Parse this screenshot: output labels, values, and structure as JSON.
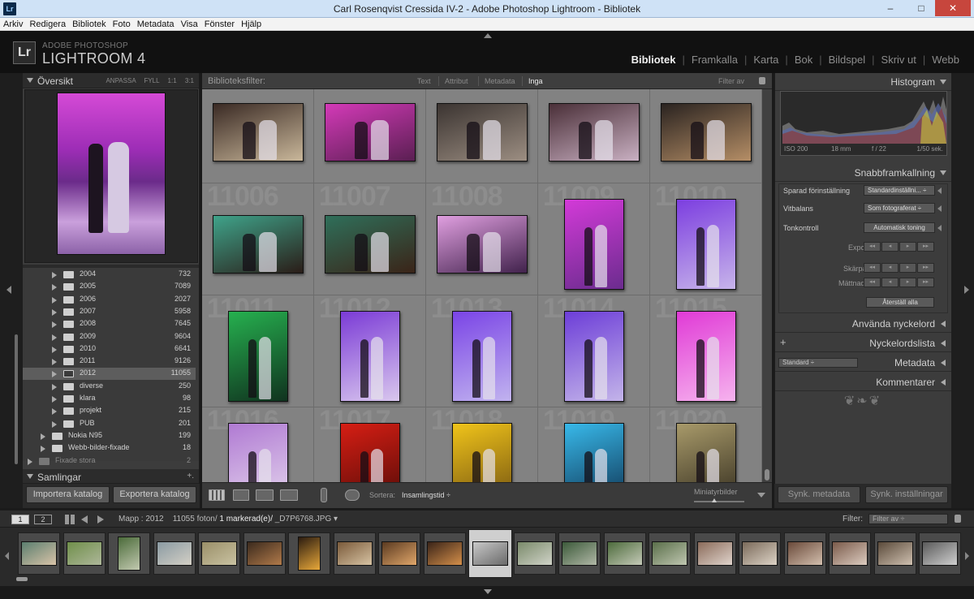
{
  "window": {
    "title": "Carl Rosenqvist Cressida IV-2 - Adobe Photoshop Lightroom - Bibliotek",
    "app_icon": "Lr",
    "minimize": "–",
    "maximize": "□",
    "close": "✕"
  },
  "menu": [
    "Arkiv",
    "Redigera",
    "Bibliotek",
    "Foto",
    "Metadata",
    "Visa",
    "Fönster",
    "Hjälp"
  ],
  "brand": {
    "logo": "Lr",
    "line1": "ADOBE PHOTOSHOP",
    "line2": "LIGHTROOM 4"
  },
  "modules": [
    "Bibliotek",
    "Framkalla",
    "Karta",
    "Bok",
    "Bildspel",
    "Skriv ut",
    "Webb"
  ],
  "active_module": "Bibliotek",
  "left": {
    "navigator": {
      "title": "Översikt",
      "options": [
        "ANPASSA",
        "FYLL",
        "1:1",
        "3:1"
      ]
    },
    "folders": [
      {
        "name": "2004",
        "count": "732",
        "indent": 1
      },
      {
        "name": "2005",
        "count": "7089",
        "indent": 1
      },
      {
        "name": "2006",
        "count": "2027",
        "indent": 1
      },
      {
        "name": "2007",
        "count": "5958",
        "indent": 1
      },
      {
        "name": "2008",
        "count": "7645",
        "indent": 1
      },
      {
        "name": "2009",
        "count": "9604",
        "indent": 1
      },
      {
        "name": "2010",
        "count": "6641",
        "indent": 1
      },
      {
        "name": "2011",
        "count": "9126",
        "indent": 1
      },
      {
        "name": "2012",
        "count": "11055",
        "indent": 1,
        "selected": true
      },
      {
        "name": "diverse",
        "count": "250",
        "indent": 1
      },
      {
        "name": "klara",
        "count": "98",
        "indent": 1
      },
      {
        "name": "projekt",
        "count": "215",
        "indent": 1
      },
      {
        "name": "PUB",
        "count": "201",
        "indent": 1
      },
      {
        "name": "Nokia N95",
        "count": "199",
        "indent": 0
      },
      {
        "name": "Webb-bilder-fixade",
        "count": "18",
        "indent": 0
      },
      {
        "name": "Fixade stora",
        "count": "2",
        "indent": -1,
        "dim": true
      }
    ],
    "collections": {
      "title": "Samlingar",
      "add": "+."
    },
    "buttons": {
      "import": "Importera katalog",
      "export": "Exportera katalog"
    }
  },
  "filter": {
    "label": "Biblioteksfilter:",
    "tabs": [
      "Text",
      "Attribut",
      "Metadata",
      "Inga"
    ],
    "active": "Inga",
    "preset": "Filter av"
  },
  "grid": {
    "cells": [
      {
        "num": "",
        "c1": "#3a2a24",
        "c2": "#c9b79a",
        "orient": "land"
      },
      {
        "num": "",
        "c1": "#d43ab8",
        "c2": "#5a1f52",
        "orient": "land"
      },
      {
        "num": "",
        "c1": "#3b3431",
        "c2": "#9c8e82",
        "orient": "land"
      },
      {
        "num": "",
        "c1": "#4a2f38",
        "c2": "#c9b0c2",
        "orient": "land"
      },
      {
        "num": "",
        "c1": "#2a2320",
        "c2": "#b58e66",
        "orient": "land"
      },
      {
        "num": "11006",
        "c1": "#3fa38a",
        "c2": "#2a1d18",
        "orient": "land"
      },
      {
        "num": "11007",
        "c1": "#2f6f5a",
        "c2": "#3a2418",
        "orient": "land"
      },
      {
        "num": "11008",
        "c1": "#e09fe0",
        "c2": "#41224c",
        "orient": "land"
      },
      {
        "num": "11009",
        "c1": "#d33ad8",
        "c2": "#6b2c8e",
        "orient": "port"
      },
      {
        "num": "11010",
        "c1": "#7c3ee0",
        "c2": "#c7b4ea",
        "orient": "port"
      },
      {
        "num": "11011",
        "c1": "#26b04f",
        "c2": "#10331f",
        "orient": "port"
      },
      {
        "num": "11012",
        "c1": "#7b3bd6",
        "c2": "#d9c7ee",
        "orient": "port"
      },
      {
        "num": "11013",
        "c1": "#7a44e6",
        "c2": "#c1b3ef",
        "orient": "port"
      },
      {
        "num": "11014",
        "c1": "#6d3ed8",
        "c2": "#c3b4e9",
        "orient": "port"
      },
      {
        "num": "11015",
        "c1": "#e03ad6",
        "c2": "#f6b3ee",
        "orient": "port"
      },
      {
        "num": "11016",
        "c1": "#b07ad3",
        "c2": "#e8dcef",
        "orient": "port"
      },
      {
        "num": "11017",
        "c1": "#d61e14",
        "c2": "#4a0a06",
        "orient": "port"
      },
      {
        "num": "11018",
        "c1": "#f0c41a",
        "c2": "#6a4a10",
        "orient": "port"
      },
      {
        "num": "11019",
        "c1": "#38b9ea",
        "c2": "#0c2a48",
        "orient": "port"
      },
      {
        "num": "11020",
        "c1": "#a89a6a",
        "c2": "#2a2418",
        "orient": "port"
      }
    ]
  },
  "toolbar": {
    "sort_label": "Sortera:",
    "sort_value": "Insamlingstid ÷",
    "thumb_label": "Miniatyrbilder"
  },
  "right": {
    "histogram": {
      "title": "Histogram",
      "info": [
        "ISO 200",
        "18 mm",
        "f / 22",
        "1/50 sek."
      ]
    },
    "quick": {
      "title": "Snabbframkallning",
      "saved_label": "Sparad förinställning",
      "saved_value": "Standardinställni... ÷",
      "wb_label": "Vitbalans",
      "wb_value": "Som fotograferat ÷",
      "tone_label": "Tonkontroll",
      "tone_button": "Automatisk toning",
      "exposure": "Exponering",
      "sharp": "Skärpa",
      "sat": "Mättnad",
      "step_buttons": [
        "◂◂",
        "◂",
        "▸",
        "▸▸"
      ],
      "reset": "Återställ alla"
    },
    "keywording": "Använda nyckelord",
    "keywordlist": "Nyckelordslista",
    "kw_plus": "+",
    "metadata": "Metadata",
    "metadata_preset": "Standard ÷",
    "comments": "Kommentarer",
    "ornament": "❦❧❦",
    "sync_meta": "Synk. metadata",
    "sync_settings": "Synk. inställningar"
  },
  "strip": {
    "monitor1": "1",
    "monitor2": "2",
    "path": "Mapp : 2012",
    "counts": "11055 foton/",
    "selected": "1 markerad(e)/",
    "filename": "_D7P6768.JPG ▾",
    "filter_label": "Filter:",
    "filter_value": "Filter av ÷",
    "thumbs": [
      {
        "c1": "#5b7e6e",
        "c2": "#d8c3a8",
        "orient": "land"
      },
      {
        "c1": "#6f8f4a",
        "c2": "#aeb79a",
        "orient": "land"
      },
      {
        "c1": "#4b6b3a",
        "c2": "#c2c9b0",
        "orient": "port"
      },
      {
        "c1": "#8a9aa2",
        "c2": "#d4d0c6",
        "orient": "land"
      },
      {
        "c1": "#9a8f68",
        "c2": "#c9c2a2",
        "orient": "land"
      },
      {
        "c1": "#3b2a1d",
        "c2": "#b17a4a",
        "orient": "land"
      },
      {
        "c1": "#2b1c10",
        "c2": "#e8a83a",
        "orient": "port"
      },
      {
        "c1": "#7a5a3a",
        "c2": "#d7c3a3",
        "orient": "land"
      },
      {
        "c1": "#5a3a20",
        "c2": "#e0a66a",
        "orient": "land"
      },
      {
        "c1": "#3a2418",
        "c2": "#d48f4a",
        "orient": "land"
      },
      {
        "c1": "#c8c8c8",
        "c2": "#6a6a6a",
        "orient": "land",
        "sel": true
      },
      {
        "c1": "#7a8a6a",
        "c2": "#d0d3c8",
        "orient": "land"
      },
      {
        "c1": "#3c5a3a",
        "c2": "#b0b7a6",
        "orient": "land"
      },
      {
        "c1": "#4d6b3c",
        "c2": "#c5cab8",
        "orient": "land"
      },
      {
        "c1": "#5a6f4a",
        "c2": "#bfc6b0",
        "orient": "land"
      },
      {
        "c1": "#8a6b5a",
        "c2": "#e0d4cc",
        "orient": "land"
      },
      {
        "c1": "#7a6a5a",
        "c2": "#ddd3c6",
        "orient": "land"
      },
      {
        "c1": "#6a4a3a",
        "c2": "#d3bfae",
        "orient": "land"
      },
      {
        "c1": "#7a5a4a",
        "c2": "#dcccc0",
        "orient": "land"
      },
      {
        "c1": "#5a4a3a",
        "c2": "#cfc0b0",
        "orient": "land"
      },
      {
        "c1": "#5a5a5a",
        "c2": "#cfcfcf",
        "orient": "land"
      }
    ]
  }
}
